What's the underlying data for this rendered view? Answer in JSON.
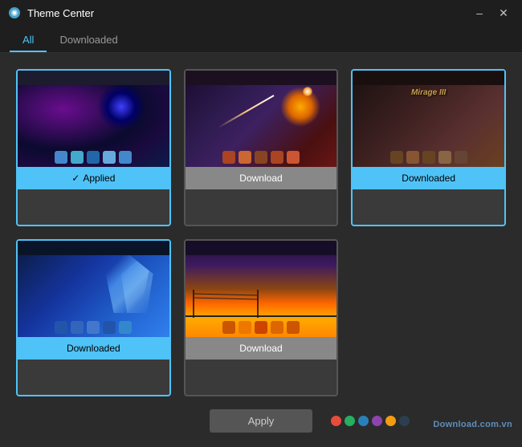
{
  "titleBar": {
    "title": "Theme Center",
    "minimizeLabel": "–",
    "closeLabel": "✕"
  },
  "tabs": [
    {
      "id": "all",
      "label": "All",
      "active": true
    },
    {
      "id": "downloaded",
      "label": "Downloaded",
      "active": false
    }
  ],
  "themes": [
    {
      "id": 1,
      "previewClass": "theme-preview-1",
      "status": "Applied",
      "statusType": "applied",
      "hasCheck": true
    },
    {
      "id": 2,
      "previewClass": "theme-preview-2",
      "status": "Download",
      "statusType": "download",
      "hasCheck": false
    },
    {
      "id": 3,
      "previewClass": "theme-preview-3",
      "status": "Downloaded",
      "statusType": "downloaded",
      "hasCheck": false,
      "overlayText": "Mirage III"
    },
    {
      "id": 4,
      "previewClass": "theme-preview-4",
      "status": "Downloaded",
      "statusType": "downloaded",
      "hasCheck": false
    },
    {
      "id": 5,
      "previewClass": "theme-preview-5",
      "status": "Download",
      "statusType": "download",
      "hasCheck": false
    }
  ],
  "bottomBar": {
    "applyLabel": "Apply"
  },
  "watermark": {
    "text": "Download.com.vn"
  },
  "colorDots": [
    {
      "color": "#e74c3c"
    },
    {
      "color": "#27ae60"
    },
    {
      "color": "#2980b9"
    },
    {
      "color": "#8e44ad"
    },
    {
      "color": "#f39c12"
    },
    {
      "color": "#2c3e50"
    }
  ]
}
